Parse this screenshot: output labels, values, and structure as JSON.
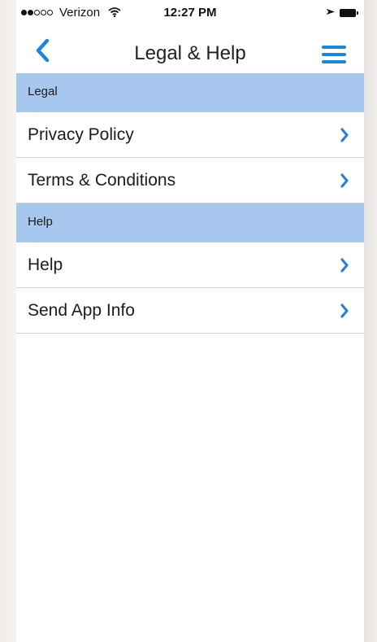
{
  "status_bar": {
    "carrier": "Verizon",
    "signal_filled": 2,
    "signal_total": 5,
    "time": "12:27 PM",
    "wifi_icon": "wifi-icon",
    "location_icon": "location-arrow-icon",
    "battery_icon": "battery-icon"
  },
  "nav": {
    "title": "Legal & Help",
    "back_icon": "chevron-left-icon",
    "menu_icon": "hamburger-menu-icon"
  },
  "sections": [
    {
      "header": "Legal",
      "items": [
        {
          "label": "Privacy Policy"
        },
        {
          "label": "Terms & Conditions"
        }
      ]
    },
    {
      "header": "Help",
      "items": [
        {
          "label": "Help"
        },
        {
          "label": "Send App Info"
        }
      ]
    }
  ],
  "colors": {
    "accent": "#1e86d6",
    "section_header_bg": "#a8c7ee",
    "chevron": "#2f7fd0"
  }
}
